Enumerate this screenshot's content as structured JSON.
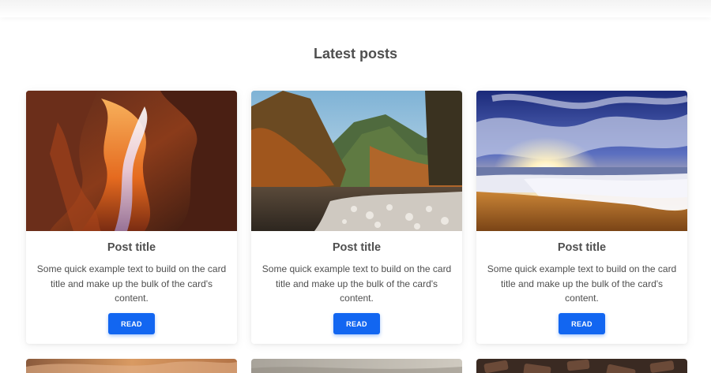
{
  "header": {
    "section_title": "Latest posts"
  },
  "posts": [
    {
      "image": "canyon-photo",
      "title": "Post title",
      "text": "Some quick example text to build on the card title and make up the bulk of the card's content.",
      "button_label": "READ"
    },
    {
      "image": "mountain-river-photo",
      "title": "Post title",
      "text": "Some quick example text to build on the card title and make up the bulk of the card's content.",
      "button_label": "READ"
    },
    {
      "image": "beach-sunset-photo",
      "title": "Post title",
      "text": "Some quick example text to build on the card title and make up the bulk of the card's content.",
      "button_label": "READ"
    }
  ],
  "colors": {
    "accent": "#1266f1",
    "text": "#4f4f4f"
  }
}
